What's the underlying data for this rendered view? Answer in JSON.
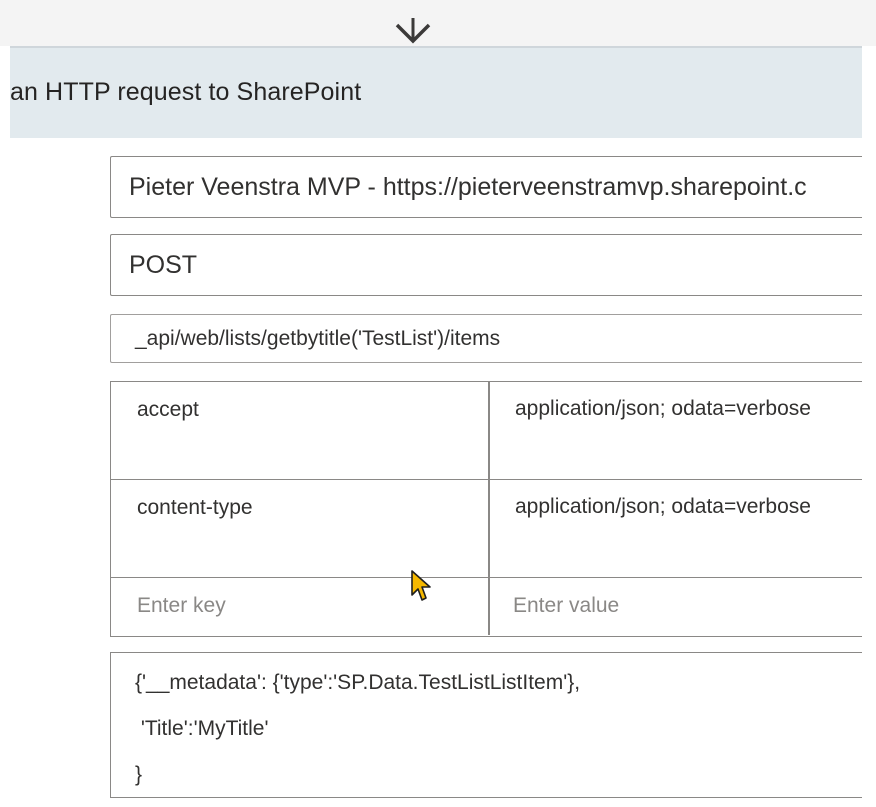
{
  "action": {
    "title": "an HTTP request to SharePoint"
  },
  "fields": {
    "site_address": "Pieter Veenstra MVP - https://pieterveenstramvp.sharepoint.c",
    "method": "POST",
    "uri": "_api/web/lists/getbytitle('TestList')/items"
  },
  "headers": {
    "rows": [
      {
        "key": "accept",
        "value": "application/json; odata=verbose"
      },
      {
        "key": "content-type",
        "value": "application/json; odata=verbose"
      }
    ],
    "key_placeholder": "Enter key",
    "value_placeholder": "Enter value"
  },
  "body": {
    "lines": [
      "{'__metadata': {'type':'SP.Data.TestListListItem'},",
      " 'Title':'MyTitle'",
      "}"
    ]
  },
  "colors": {
    "header_background": "#e2eaee",
    "field_border": "#8a8886",
    "placeholder_text": "#8a8886",
    "cursor_fill": "#f5b800"
  },
  "icons": {
    "connector": "chevron-down-icon",
    "pointer": "mouse-cursor-icon"
  }
}
